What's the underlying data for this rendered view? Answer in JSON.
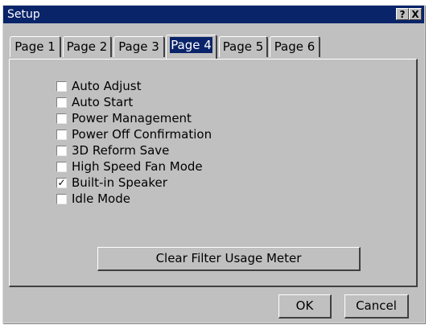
{
  "window": {
    "title": "Setup"
  },
  "titlebar_buttons": [
    {
      "label": "?",
      "icon": "help-icon"
    },
    {
      "label": "X",
      "icon": "close-icon"
    }
  ],
  "tabs": [
    {
      "label": "Page 1",
      "active": false
    },
    {
      "label": "Page 2",
      "active": false
    },
    {
      "label": "Page 3",
      "active": false
    },
    {
      "label": "Page 4",
      "active": true
    },
    {
      "label": "Page 5",
      "active": false
    },
    {
      "label": "Page 6",
      "active": false
    }
  ],
  "options": [
    {
      "label": "Auto Adjust",
      "checked": false
    },
    {
      "label": "Auto Start",
      "checked": false
    },
    {
      "label": "Power Management",
      "checked": false
    },
    {
      "label": "Power Off Confirmation",
      "checked": false
    },
    {
      "label": "3D Reform Save",
      "checked": false
    },
    {
      "label": "High Speed Fan Mode",
      "checked": false
    },
    {
      "label": "Built-in Speaker",
      "checked": true
    },
    {
      "label": "Idle Mode",
      "checked": false
    }
  ],
  "clear_filter_label": "Clear Filter Usage Meter",
  "ok_label": "OK",
  "cancel_label": "Cancel",
  "colors": {
    "titlebar": "#0a246a",
    "face": "#c0c0c0"
  }
}
